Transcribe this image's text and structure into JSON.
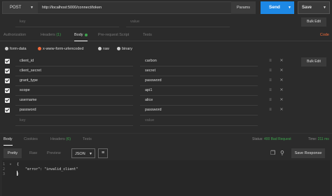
{
  "request": {
    "method": "POST",
    "url": "http://localhost:5000/connect/token",
    "params_label": "Params",
    "send_label": "Send",
    "save_label": "Save"
  },
  "header_row": {
    "key_placeholder": "key",
    "value_placeholder": "value",
    "bulk_edit": "Bulk Edit"
  },
  "request_tabs": [
    {
      "label": "Authorization"
    },
    {
      "label": "Headers",
      "count": "(1)"
    },
    {
      "label": "Body"
    },
    {
      "label": "Pre-request Script"
    },
    {
      "label": "Tests"
    }
  ],
  "code_link": "Code",
  "body_types": [
    "form-data",
    "x-www-form-urlencoded",
    "raw",
    "binary"
  ],
  "form_rows": [
    {
      "key": "client_id",
      "value": "carbon"
    },
    {
      "key": "client_secret",
      "value": "secret"
    },
    {
      "key": "grant_type",
      "value": "password"
    },
    {
      "key": "scope",
      "value": "api1"
    },
    {
      "key": "username",
      "value": "alice"
    },
    {
      "key": "password",
      "value": "password"
    }
  ],
  "new_row": {
    "key_placeholder": "key",
    "value_placeholder": "value"
  },
  "body_bulk_edit": "Bulk Edit",
  "response_tabs": [
    {
      "label": "Body"
    },
    {
      "label": "Cookies"
    },
    {
      "label": "Headers",
      "count": "(6)"
    },
    {
      "label": "Tests"
    }
  ],
  "status": {
    "label": "Status:",
    "value": "400 Bad Request"
  },
  "time": {
    "label": "Time:",
    "value": "211 ms"
  },
  "view_modes": [
    "Pretty",
    "Raw",
    "Preview"
  ],
  "language": "JSON",
  "save_response": "Save Response",
  "response_lines": [
    {
      "n": "1",
      "text": "{"
    },
    {
      "n": "2",
      "text": "    \"error\": \"invalid_client\""
    },
    {
      "n": "3",
      "text": "}"
    }
  ],
  "colors": {
    "accent_blue": "#1d88e5",
    "accent_orange": "#f26b3a",
    "status_green": "#3ea54e"
  }
}
